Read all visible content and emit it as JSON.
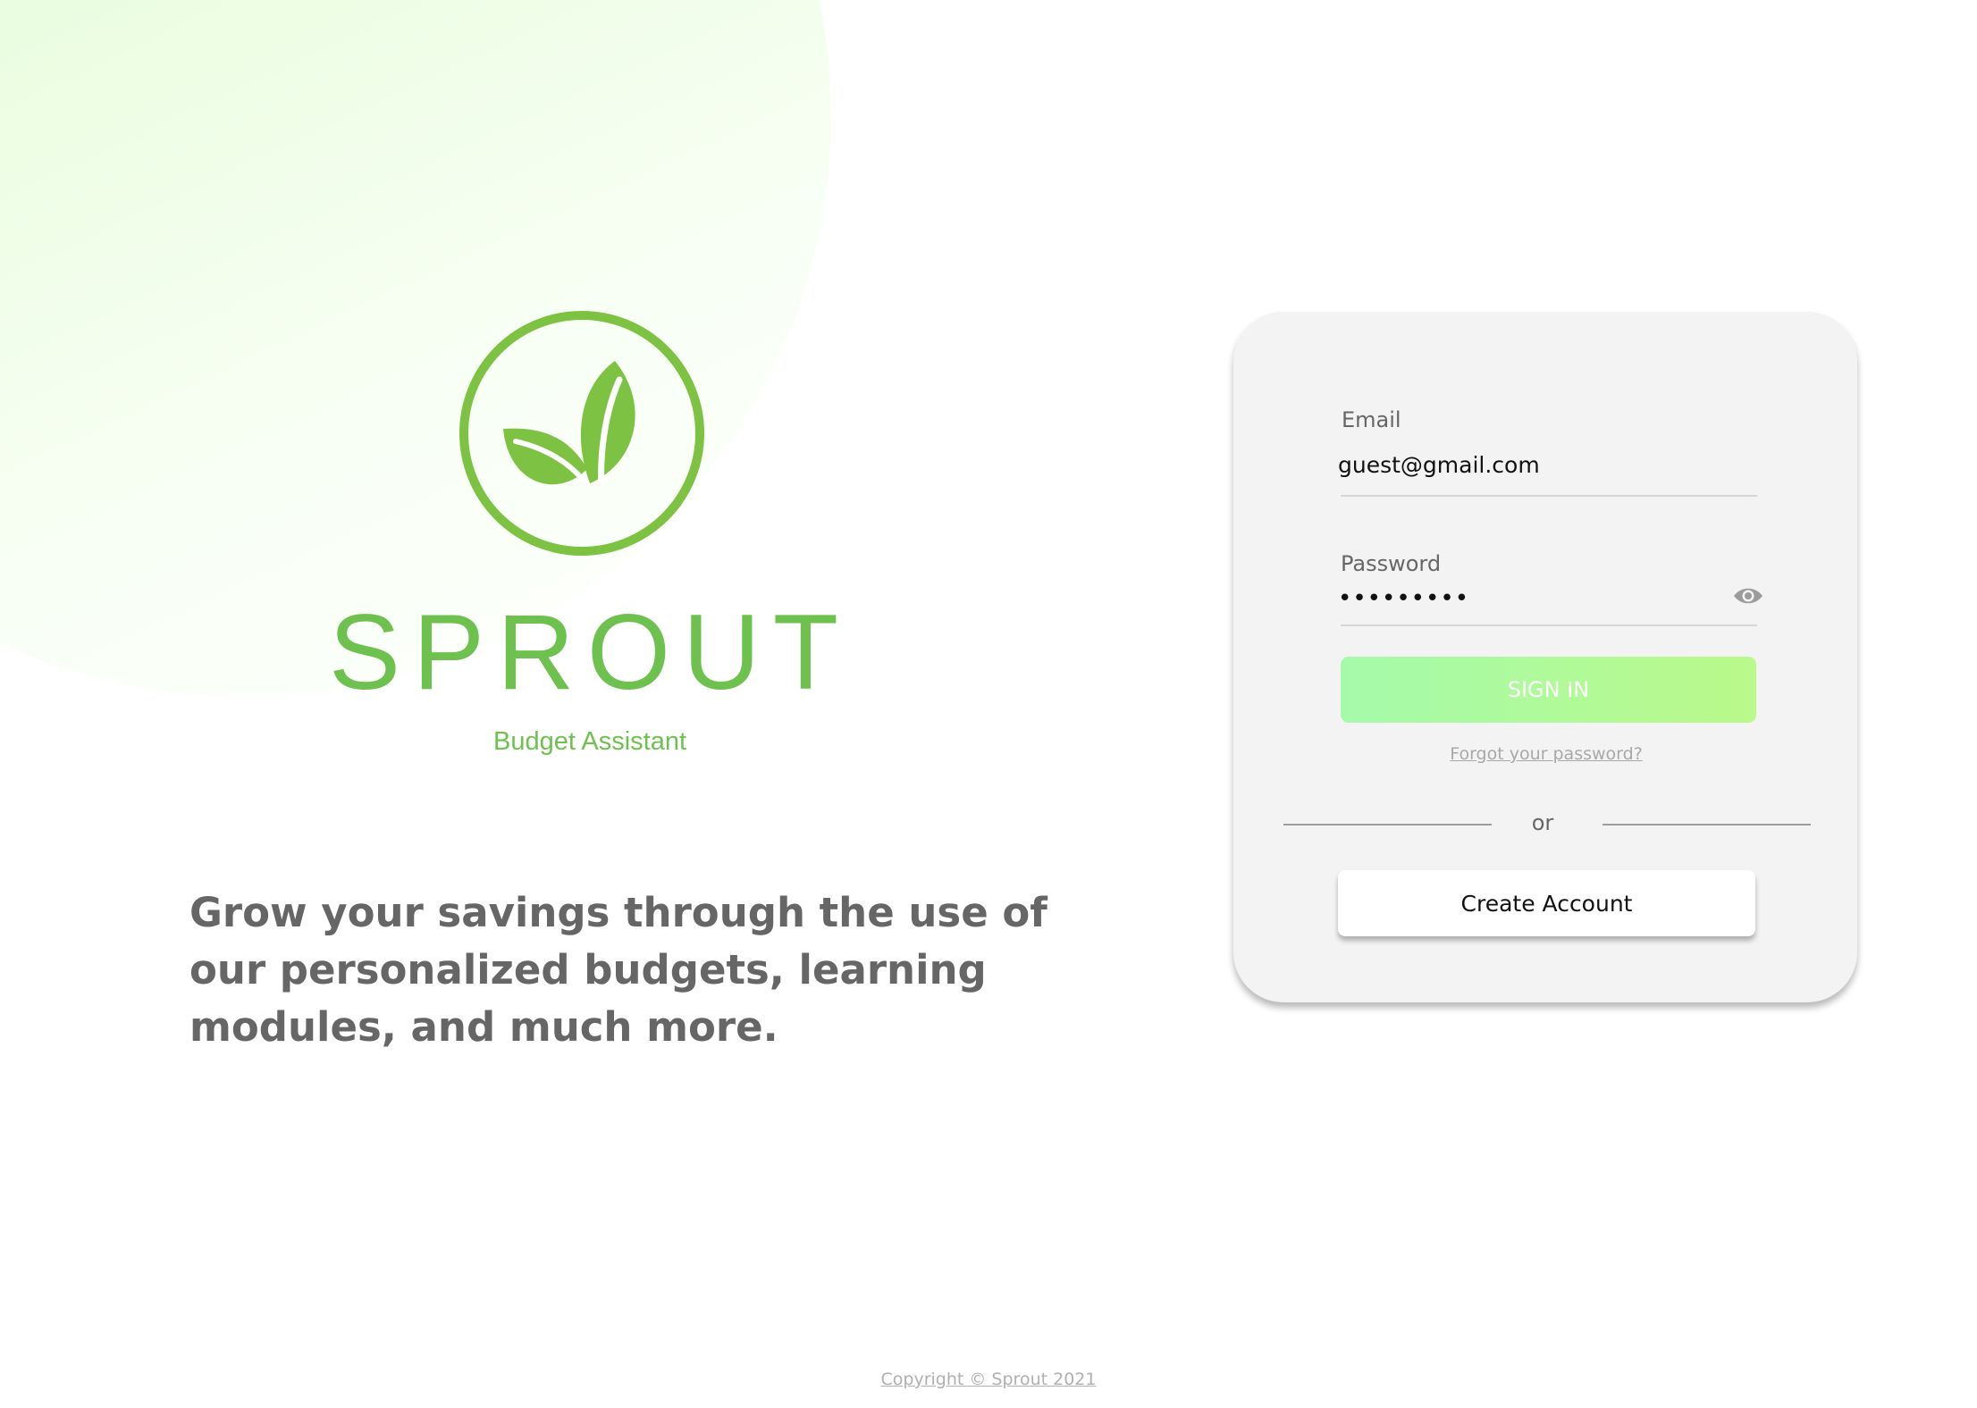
{
  "brand": {
    "name": "SPROUT",
    "tagline": "Budget Assistant",
    "logo_icon": "leaf-sprout-icon",
    "color": "#6fc14f"
  },
  "hero": {
    "headline": "Grow your savings through the use of our personalized budgets, learning modules, and much more."
  },
  "login": {
    "email_label": "Email",
    "email_value": "guest@gmail.com",
    "password_label": "Password",
    "password_mask": "•••••••••",
    "password_toggle_icon": "eye-icon",
    "signin_label": "SIGN IN",
    "forgot_label": "Forgot your password?",
    "divider_label": "or",
    "create_account_label": "Create Account",
    "accent_gradient": [
      "#a5faaa",
      "#baf98a"
    ]
  },
  "footer": {
    "copyright": "Copyright © Sprout 2021"
  }
}
